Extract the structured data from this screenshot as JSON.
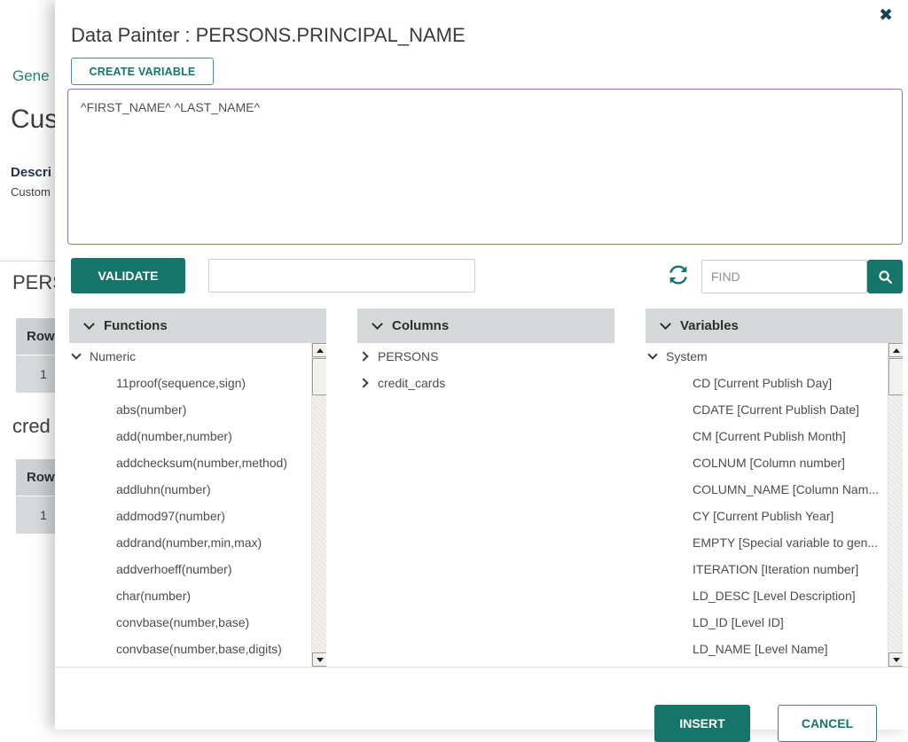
{
  "page": {
    "nav_link": "Gene",
    "title": "Cus",
    "description_label": "Descri",
    "description_text": "Custom",
    "table1_title": "PERS",
    "table1_row_header": "Row",
    "table1_row_value": "1",
    "table2_title": "cred",
    "table2_row_header": "Row",
    "table2_row_value": "1"
  },
  "modal": {
    "title": "Data Painter : PERSONS.PRINCIPAL_NAME",
    "close_icon": "✖",
    "create_variable": "CREATE VARIABLE",
    "expression": "^FIRST_NAME^ ^LAST_NAME^",
    "validate": "VALIDATE",
    "find_placeholder": "FIND",
    "insert": "INSERT",
    "cancel": "CANCEL",
    "panels": {
      "functions": {
        "title": "Functions",
        "group": "Numeric",
        "items": [
          "11proof(sequence,sign)",
          "abs(number)",
          "add(number,number)",
          "addchecksum(number,method)",
          "addluhn(number)",
          "addmod97(number)",
          "addrand(number,min,max)",
          "addverhoeff(number)",
          "char(number)",
          "convbase(number,base)",
          "convbase(number,base,digits)"
        ]
      },
      "columns": {
        "title": "Columns",
        "items": [
          "PERSONS",
          "credit_cards"
        ]
      },
      "variables": {
        "title": "Variables",
        "group": "System",
        "items": [
          "CD [Current Publish Day]",
          "CDATE [Current Publish Date]",
          "CM [Current Publish Month]",
          "COLNUM [Column number]",
          "COLUMN_NAME [Column Nam...",
          "CY [Current Publish Year]",
          "EMPTY [Special variable to gen...",
          "ITERATION [Iteration number]",
          "LD_DESC [Level Description]",
          "LD_ID [Level ID]",
          "LD_NAME [Level Name]"
        ]
      }
    }
  },
  "colors": {
    "accent_teal": "#16756b",
    "dark_teal": "#16424e",
    "link_teal": "#2e7d72",
    "editor_border": "#7b79c8",
    "panel_header_bg": "#d4d8d8"
  }
}
